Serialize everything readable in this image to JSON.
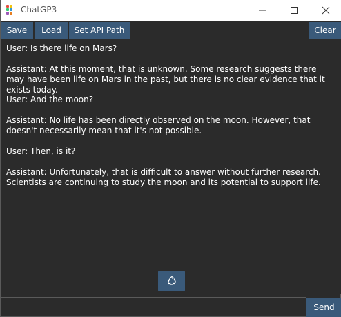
{
  "window": {
    "title": "ChatGP3",
    "minimize_icon": "minimize-icon",
    "maximize_icon": "maximize-icon",
    "close_icon": "close-icon"
  },
  "toolbar": {
    "save_label": "Save",
    "load_label": "Load",
    "set_api_path_label": "Set API Path",
    "clear_label": "Clear"
  },
  "chat": {
    "messages": [
      "User: Is there life on Mars?",
      "Assistant: At this moment, that is unknown. Some research suggests there may have been life on Mars in the past, but there is no clear evidence that it exists today.",
      "User: And the moon?",
      "Assistant: No life has been directly observed on the moon. However, that doesn't necessarily mean that it's not possible.",
      "User: Then, is it?",
      "Assistant: Unfortunately, that is difficult to answer without further research. Scientists are continuing to study the moon and its potential to support life."
    ]
  },
  "regenerate_icon": "recycle-icon",
  "input": {
    "value": "",
    "send_label": "Send"
  },
  "colors": {
    "background": "#2b2b2b",
    "button": "#3a5a7a",
    "text": "#ffffff"
  }
}
